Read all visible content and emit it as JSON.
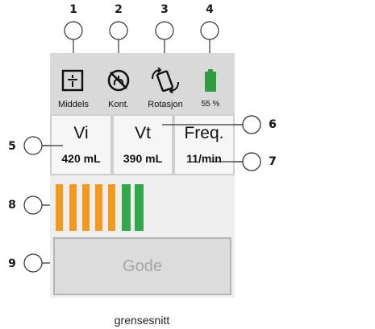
{
  "callouts": [
    "1",
    "2",
    "3",
    "4",
    "5",
    "6",
    "7",
    "8",
    "9"
  ],
  "toolbar": {
    "items": [
      {
        "label": "Middels",
        "icon": "sensitivity-icon"
      },
      {
        "label": "Kont.",
        "icon": "continuous-mode-icon"
      },
      {
        "label": "Rotasjon",
        "icon": "rotation-icon"
      },
      {
        "label": "55 %",
        "icon": "battery-icon"
      }
    ]
  },
  "panels": [
    {
      "title": "Vi",
      "value": "420 mL"
    },
    {
      "title": "Vt",
      "value": "390 mL"
    },
    {
      "title": "Freq.",
      "value": "11/min"
    }
  ],
  "bars": [
    {
      "color": "#f39a1e"
    },
    {
      "color": "#f39a1e"
    },
    {
      "color": "#f39a1e"
    },
    {
      "color": "#f39a1e"
    },
    {
      "color": "#f39a1e"
    },
    {
      "color": "#33a84a"
    },
    {
      "color": "#33a84a"
    }
  ],
  "action_button": {
    "label": "Gode"
  },
  "caption": "grensesnitt",
  "colors": {
    "battery": "#2e9e3e",
    "orange": "#f39a1e",
    "green": "#33a84a"
  }
}
